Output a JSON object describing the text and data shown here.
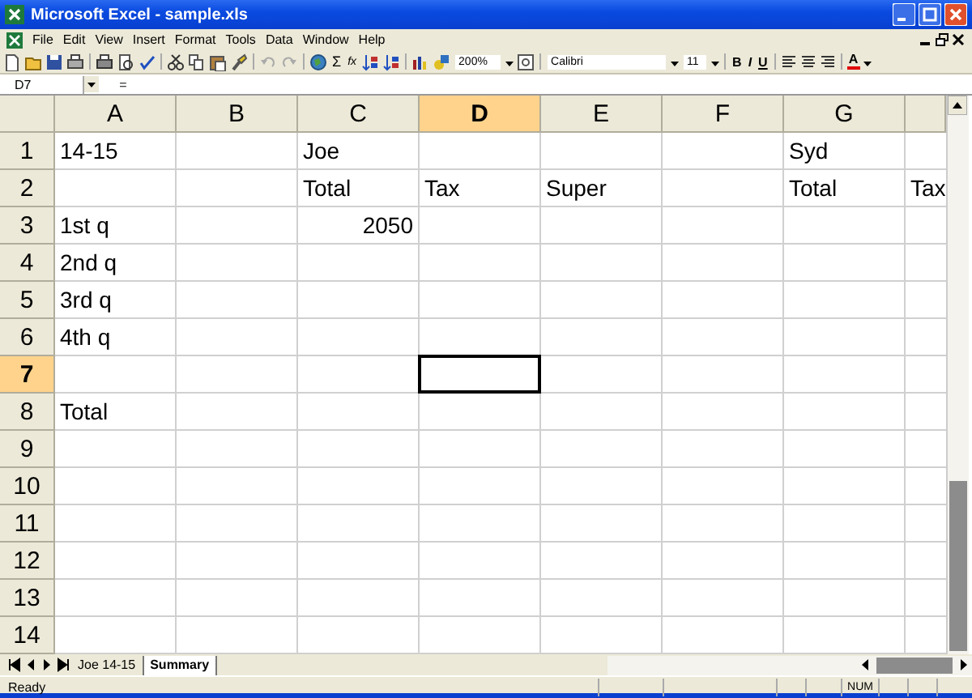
{
  "window": {
    "title": "Microsoft Excel - sample.xls"
  },
  "menu": [
    "File",
    "Edit",
    "View",
    "Insert",
    "Format",
    "Tools",
    "Data",
    "Window",
    "Help"
  ],
  "toolbar": {
    "sum_button": "Σ",
    "function_button": "fx",
    "zoom": "200%",
    "font": "Calibri",
    "font_size": "11",
    "bold_button": "B",
    "italic_button": "I",
    "underline_button": "U",
    "font_color_button": "A"
  },
  "formula_bar": {
    "name_box": "D7",
    "equals": "="
  },
  "columns": [
    {
      "label": "A",
      "selected": false
    },
    {
      "label": "B",
      "selected": false
    },
    {
      "label": "C",
      "selected": false
    },
    {
      "label": "D",
      "selected": true
    },
    {
      "label": "E",
      "selected": false
    },
    {
      "label": "F",
      "selected": false
    },
    {
      "label": "G",
      "selected": false
    }
  ],
  "rows": [
    {
      "label": "1",
      "selected": false,
      "cells": {
        "A": "14-15",
        "C": "Joe",
        "G": "Syd"
      }
    },
    {
      "label": "2",
      "selected": false,
      "cells": {
        "C": "Total",
        "D": "Tax",
        "E": "Super",
        "G": "Total",
        "H": "Tax"
      }
    },
    {
      "label": "3",
      "selected": false,
      "cells": {
        "A": "1st q",
        "C": "2050"
      }
    },
    {
      "label": "4",
      "selected": false,
      "cells": {
        "A": "2nd q"
      }
    },
    {
      "label": "5",
      "selected": false,
      "cells": {
        "A": "3rd q"
      }
    },
    {
      "label": "6",
      "selected": false,
      "cells": {
        "A": "4th q"
      }
    },
    {
      "label": "7",
      "selected": true
    },
    {
      "label": "8",
      "selected": false,
      "cells": {
        "A": "Total"
      }
    },
    {
      "label": "9",
      "selected": false
    },
    {
      "label": "10",
      "selected": false
    },
    {
      "label": "11",
      "selected": false
    },
    {
      "label": "12",
      "selected": false
    },
    {
      "label": "13",
      "selected": false
    },
    {
      "label": "14",
      "selected": false
    }
  ],
  "sheet_tabs": [
    {
      "label": "Joe 14-15",
      "selected": false
    },
    {
      "label": "Summary",
      "selected": true
    }
  ],
  "status_bar": {
    "status": "Ready",
    "indicator": "NUM"
  }
}
